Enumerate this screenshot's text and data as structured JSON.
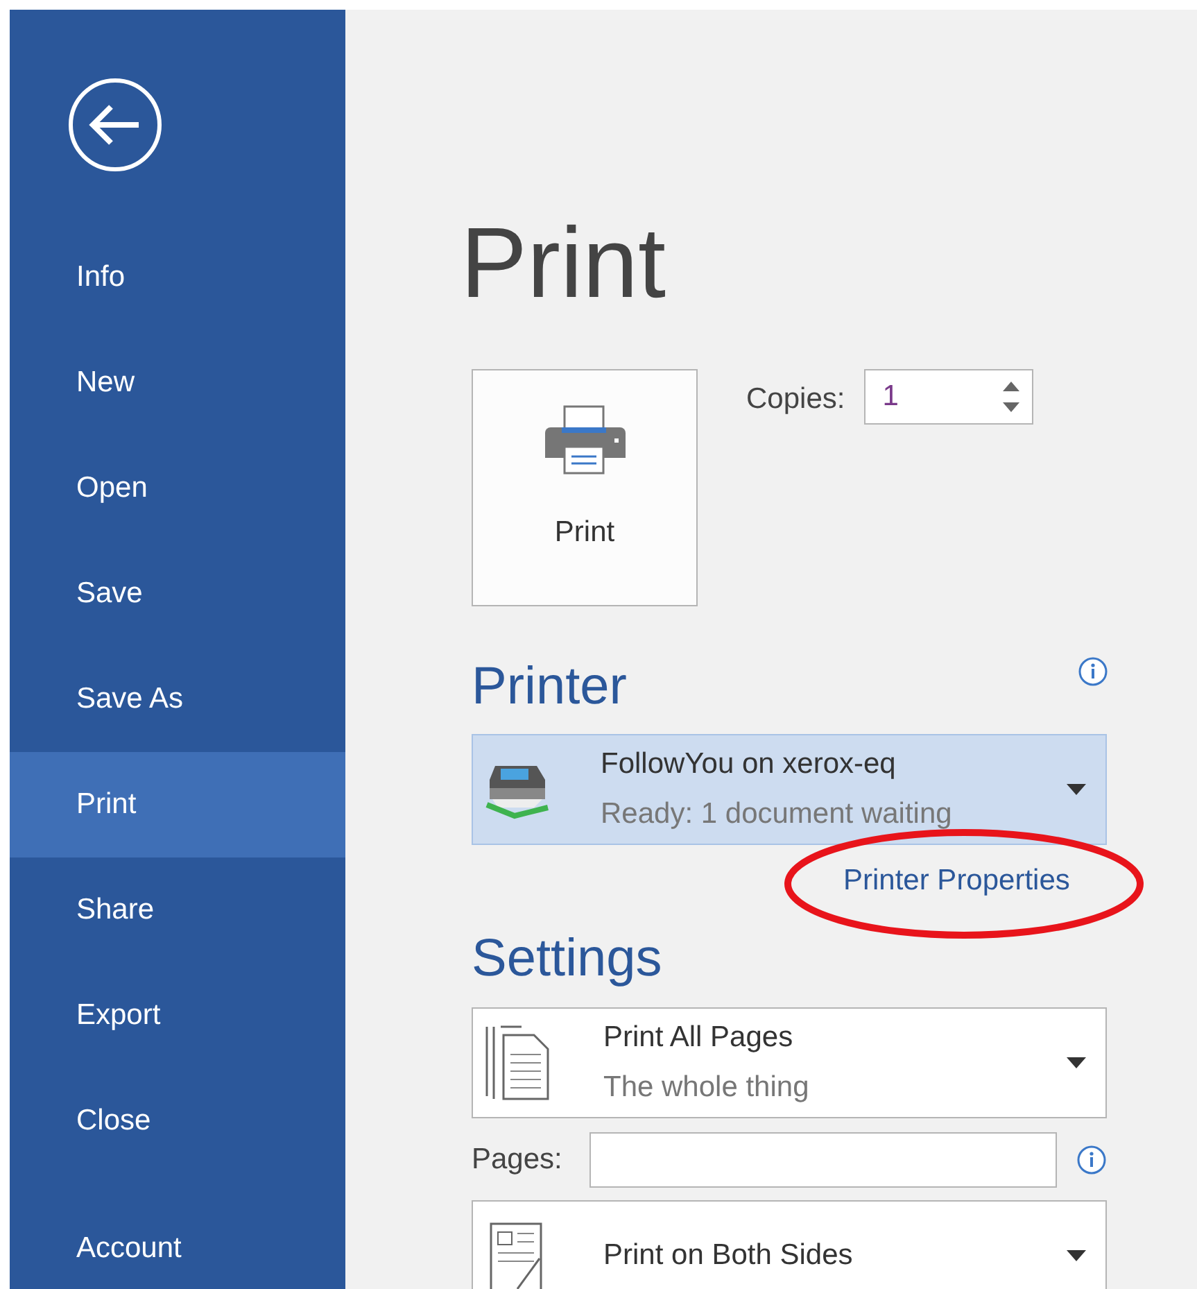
{
  "sidebar": {
    "items": [
      {
        "label": "Info",
        "selected": false
      },
      {
        "label": "New",
        "selected": false
      },
      {
        "label": "Open",
        "selected": false
      },
      {
        "label": "Save",
        "selected": false
      },
      {
        "label": "Save As",
        "selected": false
      },
      {
        "label": "Print",
        "selected": true
      },
      {
        "label": "Share",
        "selected": false
      },
      {
        "label": "Export",
        "selected": false
      },
      {
        "label": "Close",
        "selected": false
      }
    ],
    "footer_items": [
      {
        "label": "Account",
        "selected": false
      }
    ]
  },
  "main": {
    "title": "Print",
    "print_button": {
      "label": "Print"
    },
    "copies": {
      "label": "Copies:",
      "value": "1"
    },
    "printer": {
      "heading": "Printer",
      "name": "FollowYou on xerox-eq",
      "status": "Ready: 1 document waiting",
      "properties_link": "Printer Properties"
    },
    "settings": {
      "heading": "Settings",
      "options": [
        {
          "kind": "pages",
          "title": "Print All Pages",
          "subtitle": "The whole thing"
        },
        {
          "kind": "duplex",
          "title": "Print on Both Sides"
        }
      ],
      "pages": {
        "label": "Pages:"
      }
    }
  }
}
